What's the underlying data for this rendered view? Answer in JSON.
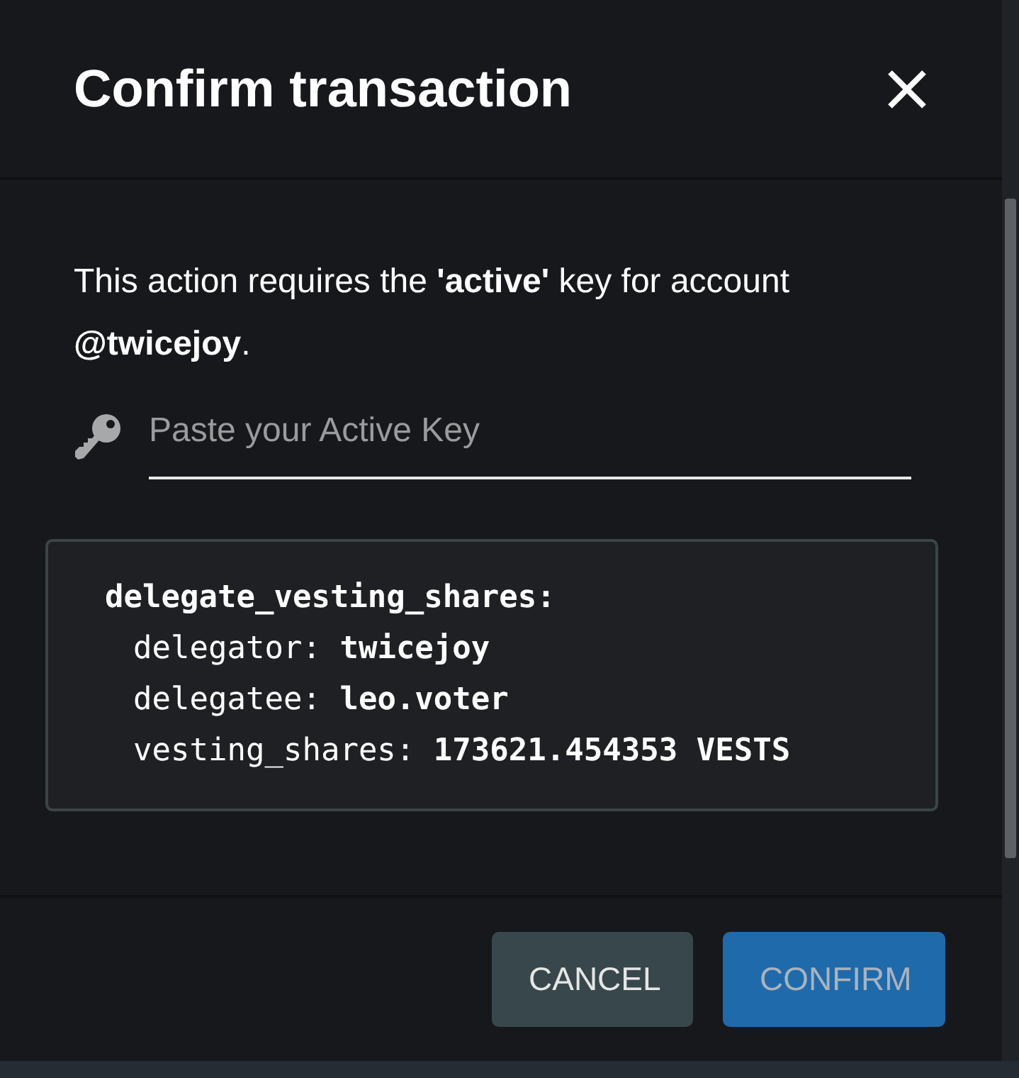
{
  "dialog": {
    "title": "Confirm transaction",
    "message": "This action requires the **'active'** key for account **@twicejoy**.",
    "key_field": {
      "placeholder": "Paste your Active Key"
    },
    "operation": {
      "name": "delegate_vesting_shares:",
      "lines": [
        "delegator: **twicejoy**",
        "delegatee: **leo.voter**",
        "vesting_shares: **173621.454353 VESTS**"
      ]
    },
    "buttons": [
      {
        "label": "CANCEL",
        "kind": "secondary",
        "disabled": false
      },
      {
        "label": "CONFIRM",
        "kind": "primary",
        "disabled": true
      }
    ]
  }
}
